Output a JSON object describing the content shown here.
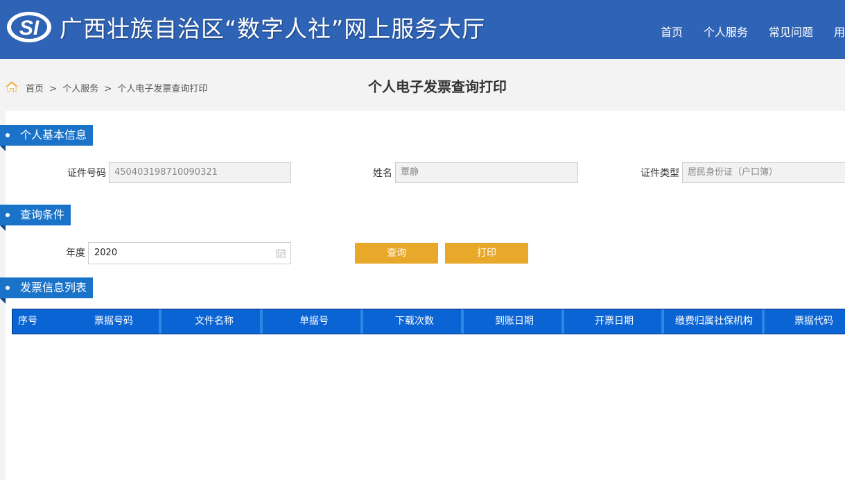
{
  "header": {
    "logo_text": "SI",
    "title": "广西壮族自治区“数字人社”网上服务大厅",
    "nav": [
      {
        "label": "首页"
      },
      {
        "label": "个人服务"
      },
      {
        "label": "常见问题"
      },
      {
        "label": "用"
      }
    ],
    "background_color": "#2f63b5"
  },
  "breadcrumb": {
    "home": "首页",
    "sep": ">",
    "level1": "个人服务",
    "level2": "个人电子发票查询打印"
  },
  "page_title": "个人电子发票查询打印",
  "sections": {
    "basic_info": {
      "title": "个人基本信息",
      "id_number_label": "证件号码",
      "id_number_value": "450403198710090321",
      "name_label": "姓名",
      "name_value": "覃静",
      "id_type_label": "证件类型",
      "id_type_value": "居民身份证（户口簿）"
    },
    "query": {
      "title": "查询条件",
      "year_label": "年度",
      "year_value": "2020",
      "query_button": "查询",
      "print_button": "打印"
    },
    "invoice_list": {
      "title": "发票信息列表",
      "columns": [
        "序号",
        "票据号码",
        "文件名称",
        "单据号",
        "下载次数",
        "到账日期",
        "开票日期",
        "缴费归属社保机构",
        "票据代码"
      ],
      "rows": []
    }
  },
  "colors": {
    "section_tag": "#1a73c9",
    "button": "#e8a829",
    "table_header": "#0a64d4"
  }
}
